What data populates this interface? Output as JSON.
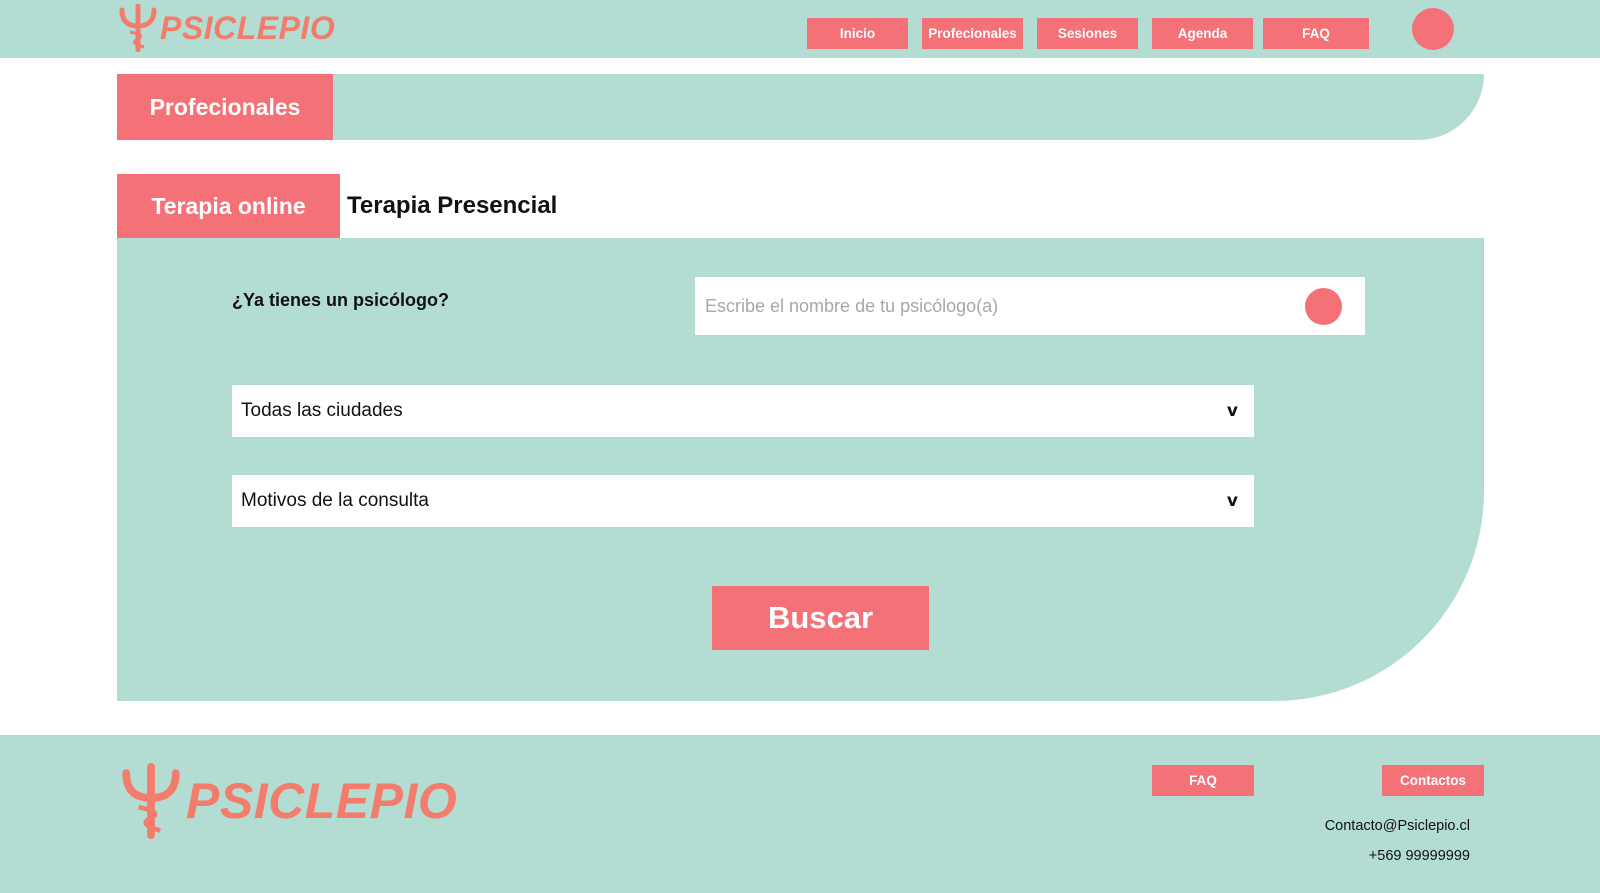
{
  "colors": {
    "accent": "#f47177",
    "mint": "#b3ddd2",
    "logo": "#f37c6c"
  },
  "header": {
    "logo_text": "PSICLEPIO",
    "logo_icon": "psi-caduceus-icon",
    "nav": [
      {
        "label": "Inicio"
      },
      {
        "label": "Profecionales"
      },
      {
        "label": "Sesiones"
      },
      {
        "label": "Agenda"
      },
      {
        "label": "FAQ"
      }
    ],
    "avatar_icon": "user-avatar-icon"
  },
  "section": {
    "title": "Profecionales"
  },
  "tabs": {
    "online": "Terapia online",
    "presencial": "Terapia Presencial",
    "active": "online"
  },
  "search": {
    "question": "¿Ya tienes un psicólogo?",
    "input_placeholder": "Escribe el nombre de tu psicólogo(a)",
    "input_value": "",
    "search_icon": "search-circle-icon",
    "city_select": "Todas las ciudades",
    "motive_select": "Motivos de la consulta",
    "chevron": "v",
    "button_label": "Buscar"
  },
  "footer": {
    "logo_text": "PSICLEPIO",
    "faq_label": "FAQ",
    "contact_label": "Contactos",
    "email": "Contacto@Psiclepio.cl",
    "phone": "+569 99999999"
  }
}
